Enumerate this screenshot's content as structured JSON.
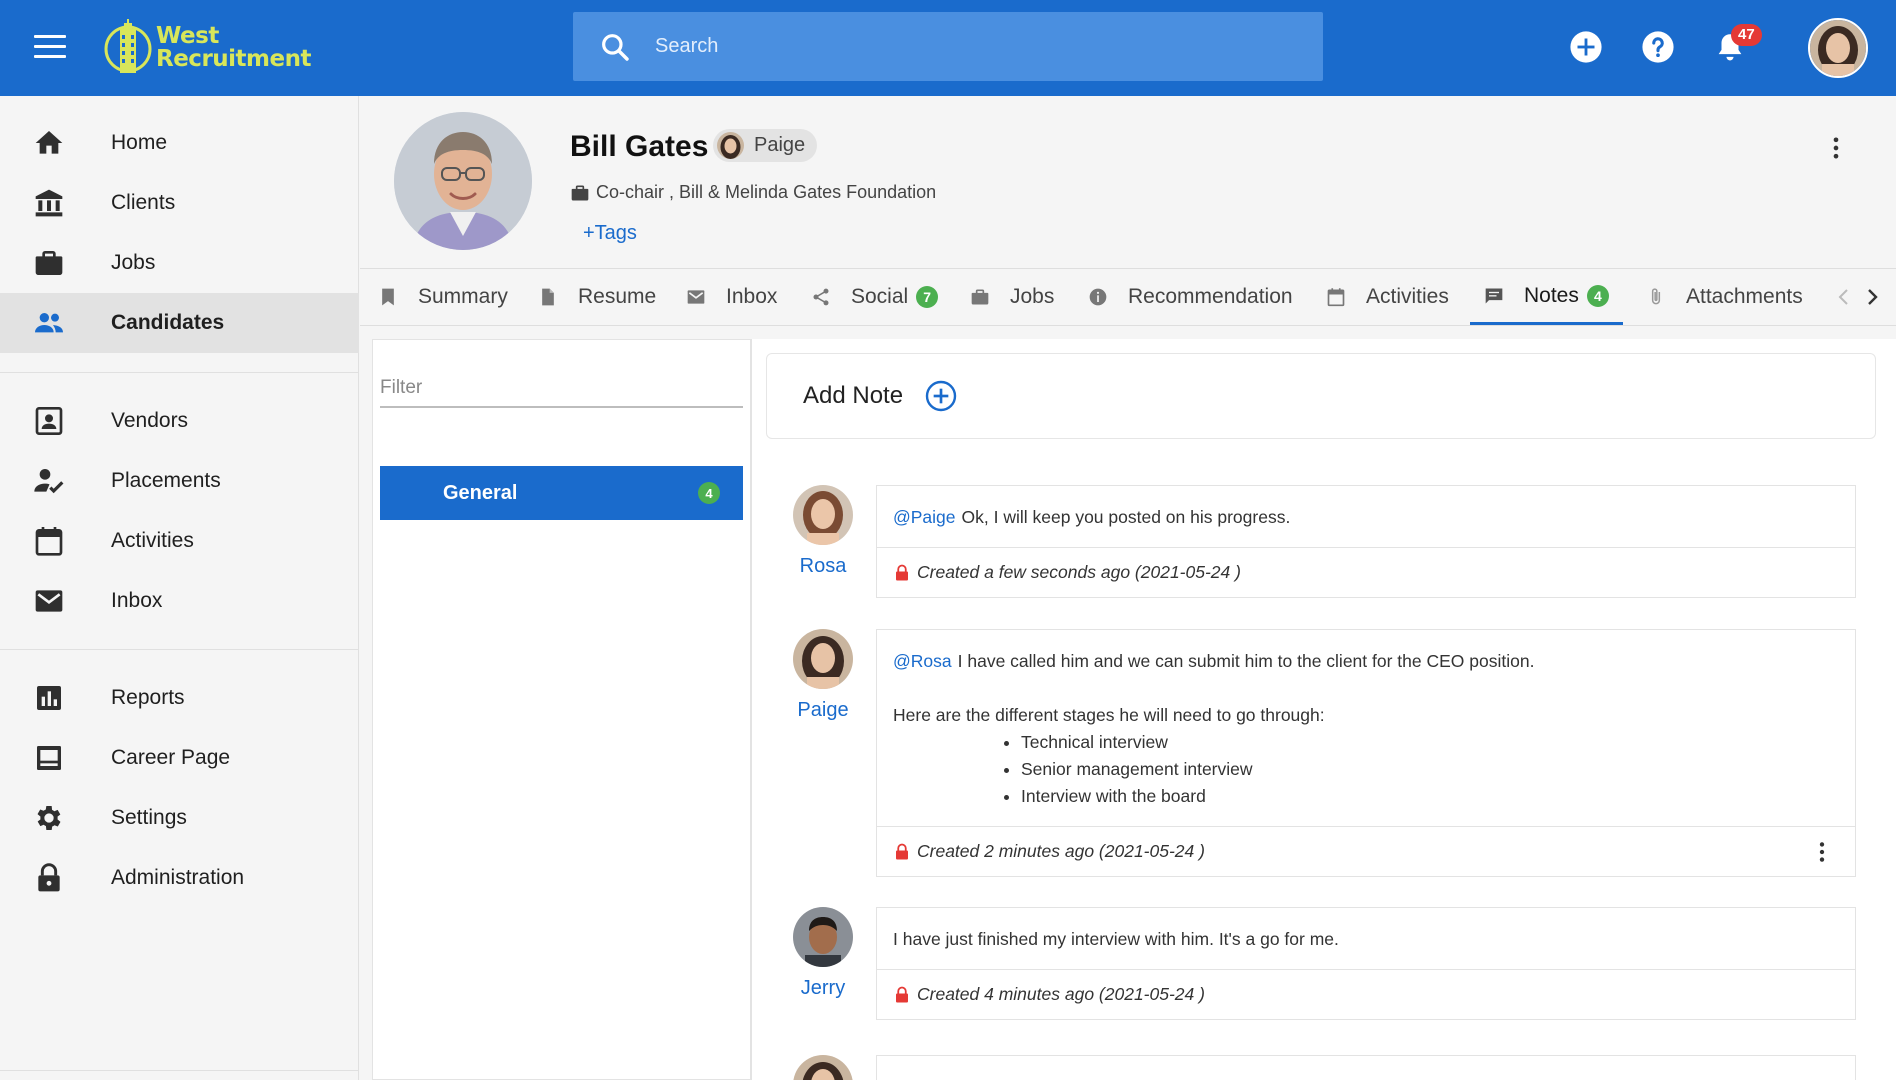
{
  "app": {
    "logo_line1": "West",
    "logo_line2": "Recruitment"
  },
  "search": {
    "placeholder": "Search"
  },
  "notifications": {
    "count": "47"
  },
  "sidebar": {
    "items": [
      {
        "label": "Home",
        "icon": "home-icon"
      },
      {
        "label": "Clients",
        "icon": "bank-icon"
      },
      {
        "label": "Jobs",
        "icon": "briefcase-icon"
      },
      {
        "label": "Candidates",
        "icon": "people-icon",
        "active": true
      },
      {
        "label": "Vendors",
        "icon": "contact-card-icon"
      },
      {
        "label": "Placements",
        "icon": "person-check-icon"
      },
      {
        "label": "Activities",
        "icon": "calendar-icon"
      },
      {
        "label": "Inbox",
        "icon": "mail-icon"
      },
      {
        "label": "Reports",
        "icon": "bar-chart-icon"
      },
      {
        "label": "Career Page",
        "icon": "web-page-icon"
      },
      {
        "label": "Settings",
        "icon": "gear-icon"
      },
      {
        "label": "Administration",
        "icon": "lock-icon"
      }
    ]
  },
  "candidate": {
    "name": "Bill Gates",
    "owner": "Paige",
    "title": "Co-chair , Bill & Melinda Gates Foundation",
    "tags_link": "+Tags"
  },
  "tabs": [
    {
      "label": "Summary",
      "icon": "bookmark-icon"
    },
    {
      "label": "Resume",
      "icon": "document-icon"
    },
    {
      "label": "Inbox",
      "icon": "mail-icon"
    },
    {
      "label": "Social",
      "icon": "share-icon",
      "badge": "7"
    },
    {
      "label": "Jobs",
      "icon": "briefcase-icon"
    },
    {
      "label": "Recommendation",
      "icon": "info-icon"
    },
    {
      "label": "Activities",
      "icon": "calendar-icon"
    },
    {
      "label": "Notes",
      "icon": "comment-icon",
      "badge": "4",
      "active": true
    },
    {
      "label": "Attachments",
      "icon": "paperclip-icon"
    }
  ],
  "filter": {
    "placeholder": "Filter",
    "categories": [
      {
        "label": "General",
        "count": "4"
      }
    ]
  },
  "notes": {
    "add_label": "Add Note",
    "items": [
      {
        "author": "Rosa",
        "mention": "@Paige",
        "text": "Ok, I will keep you posted on his progress.",
        "footer": "Created a few seconds ago (2021-05-24 )"
      },
      {
        "author": "Paige",
        "mention": "@Rosa",
        "text": "I have called him and we can submit him to the client for the CEO position.",
        "text2": "Here are the different stages he will need to go through:",
        "list": [
          "Technical interview",
          "Senior management interview",
          "Interview with the board"
        ],
        "footer": "Created 2 minutes ago (2021-05-24 )"
      },
      {
        "author": "Jerry",
        "text": "I have just finished my interview with him. It's a go for me.",
        "footer": "Created 4 minutes ago (2021-05-24 )"
      }
    ]
  },
  "colors": {
    "primary": "#1a6bcc",
    "badge_green": "#4caf50",
    "badge_red": "#e53935",
    "logo_yellow": "#d8e65a"
  }
}
